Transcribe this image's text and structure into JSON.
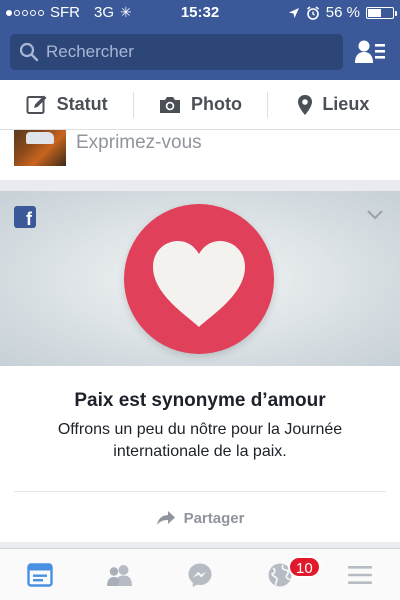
{
  "status_bar": {
    "carrier": "SFR",
    "network": "3G",
    "time": "15:32",
    "battery_text": "56 %",
    "battery_level": 0.56,
    "signal_bars": 1
  },
  "search": {
    "placeholder": "Rechercher"
  },
  "composer": {
    "items": [
      {
        "label": "Statut",
        "icon": "edit-icon"
      },
      {
        "label": "Photo",
        "icon": "camera-icon"
      },
      {
        "label": "Lieux",
        "icon": "location-pin-icon"
      }
    ],
    "prompt": "Exprimez-vous"
  },
  "card": {
    "title": "Paix est synonyme d’amour",
    "description": "Offrons un peu du nôtre pour la Journée internationale de la paix.",
    "share_label": "Partager",
    "heart_color": "#e04059"
  },
  "tabbar": {
    "tabs": [
      {
        "name": "news-feed",
        "icon": "news-feed-icon",
        "active": true
      },
      {
        "name": "friends",
        "icon": "friends-icon",
        "active": false
      },
      {
        "name": "messenger",
        "icon": "messenger-icon",
        "active": false
      },
      {
        "name": "notifications",
        "icon": "globe-icon",
        "active": false
      },
      {
        "name": "more",
        "icon": "menu-icon",
        "active": false
      }
    ],
    "notifications_badge": "10"
  },
  "colors": {
    "brand": "#3b5998",
    "badge": "#e0192b",
    "active_tab": "#4a90e2"
  }
}
